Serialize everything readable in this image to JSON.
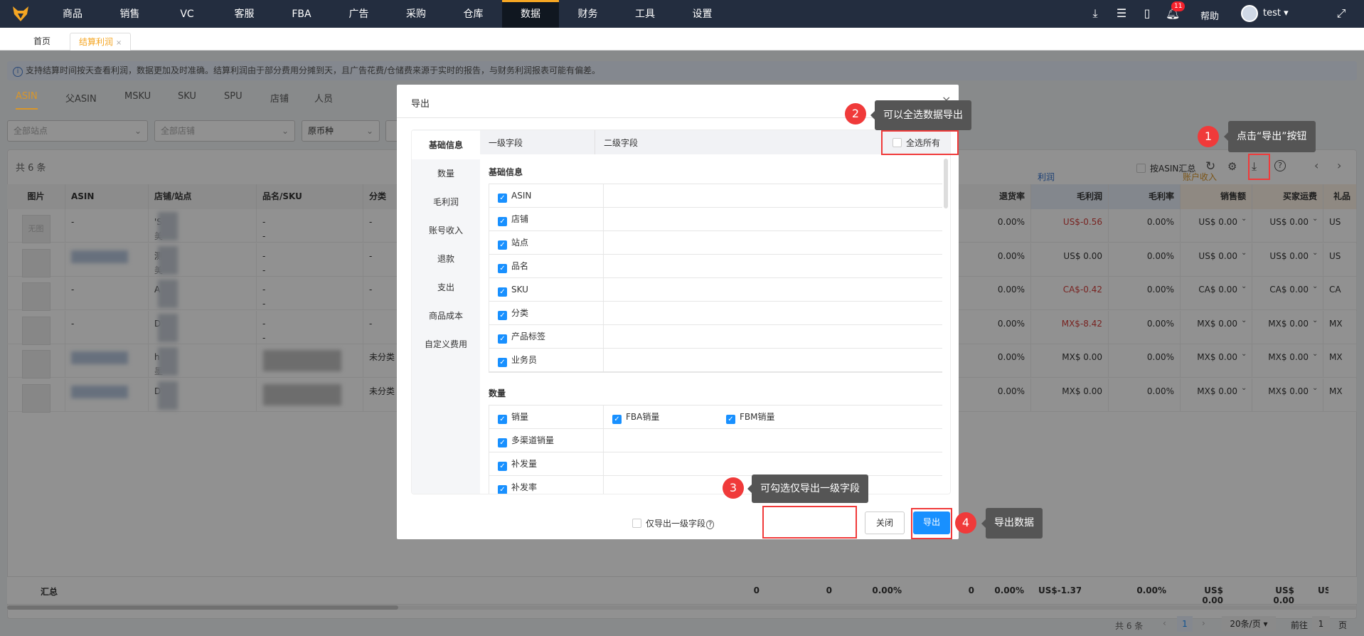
{
  "nav": {
    "items": [
      "商品",
      "销售",
      "VC",
      "客服",
      "FBA",
      "广告",
      "采购",
      "仓库",
      "数据",
      "财务",
      "工具",
      "设置"
    ],
    "active": 8,
    "help": "帮助",
    "user": "test",
    "notifications": "11"
  },
  "tabs": [
    {
      "label": "首页"
    },
    {
      "label": "结算利润",
      "close": "×"
    }
  ],
  "info": "支持结算时间按天查看利润，数据更加及时准确。结算利润由于部分费用分摊到天，且广告花费/仓储费来源于实时的报告，与财务利润报表可能有偏差。",
  "subtabs": [
    "ASIN",
    "父ASIN",
    "MSKU",
    "SKU",
    "SPU",
    "店铺",
    "人员"
  ],
  "filters": {
    "site": "全部站点",
    "store": "全部店铺",
    "currency": "原币种"
  },
  "table": {
    "count": "共 6 条",
    "asin_summary": "按ASIN汇总",
    "group_profit": "利润",
    "group_income": "账户收入",
    "left_headers": [
      "图片",
      "ASIN",
      "店铺/站点",
      "品名/SKU",
      "分类"
    ],
    "right_headers": [
      "退货率",
      "毛利润",
      "毛利率",
      "销售额",
      "买家运费",
      "礼品包"
    ],
    "no_image": "无图",
    "rows": [
      {
        "asin": "-",
        "store": "'S",
        "site": "美",
        "name": "-",
        "sku": "-",
        "cat": "-",
        "vals": [
          "0.00%",
          "US$-0.56",
          "0.00%",
          "US$ 0.00",
          "US$ 0.00",
          "US"
        ],
        "neg": true
      },
      {
        "asin": "",
        "store": "测",
        "site": "美",
        "name": "-",
        "sku": "-",
        "cat": "-",
        "vals": [
          "0.00%",
          "US$ 0.00",
          "0.00%",
          "US$ 0.00",
          "US$ 0.00",
          "US"
        ],
        "neg": false
      },
      {
        "asin": "-",
        "store": "A",
        "site": "",
        "name": "-",
        "sku": "-",
        "cat": "-",
        "vals": [
          "0.00%",
          "CA$-0.42",
          "0.00%",
          "CA$ 0.00",
          "CA$ 0.00",
          "CA"
        ],
        "neg": true
      },
      {
        "asin": "-",
        "store": "DY",
        "site": "",
        "name": "-",
        "sku": "-",
        "cat": "-",
        "vals": [
          "0.00%",
          "MX$-8.42",
          "0.00%",
          "MX$ 0.00",
          "MX$ 0.00",
          "MX"
        ],
        "neg": true
      },
      {
        "asin": "",
        "store": "h DY",
        "site": "墨",
        "name": "",
        "sku": "",
        "cat": "未分类",
        "vals": [
          "0.00%",
          "MX$ 0.00",
          "0.00%",
          "MX$ 0.00",
          "MX$ 0.00",
          "MX"
        ],
        "neg": false
      },
      {
        "asin": "",
        "store": "DY",
        "site": "",
        "name": "",
        "sku": "",
        "cat": "未分类",
        "vals": [
          "0.00%",
          "MX$ 0.00",
          "0.00%",
          "MX$ 0.00",
          "MX$ 0.00",
          "MX"
        ],
        "neg": false
      }
    ],
    "total_label": "汇总",
    "totals": [
      "0",
      "0",
      "0.00%",
      "0",
      "0.00%",
      "US$-1.37",
      "0.00%",
      "US$ 0.00",
      "US$ 0.00",
      "US"
    ]
  },
  "pagination": {
    "total": "共 6 条",
    "page": "1",
    "page_size": "20条/页",
    "goto": "前往",
    "goto_value": "1",
    "page_unit": "页"
  },
  "modal": {
    "title": "导出",
    "close": "×",
    "left_nav": [
      "基础信息",
      "数量",
      "毛利润",
      "账号收入",
      "退款",
      "支出",
      "商品成本",
      "自定义费用"
    ],
    "col1": "一级字段",
    "col2": "二级字段",
    "select_all": "全选所有",
    "sections": [
      {
        "title": "基础信息",
        "rows": [
          {
            "label": "ASIN"
          },
          {
            "label": "店铺"
          },
          {
            "label": "站点"
          },
          {
            "label": "品名"
          },
          {
            "label": "SKU"
          },
          {
            "label": "分类"
          },
          {
            "label": "产品标签"
          },
          {
            "label": "业务员"
          }
        ]
      },
      {
        "title": "数量",
        "rows": [
          {
            "label": "销量",
            "sub": [
              "FBA销量",
              "FBM销量"
            ]
          },
          {
            "label": "多渠道销量"
          },
          {
            "label": "补发量"
          },
          {
            "label": "补发率"
          }
        ]
      }
    ],
    "only_level1": "仅导出一级字段",
    "close_btn": "关闭",
    "export_btn": "导出"
  },
  "annotations": [
    {
      "num": "1",
      "text": "点击“导出”按钮"
    },
    {
      "num": "2",
      "text": "可以全选数据导出"
    },
    {
      "num": "3",
      "text": "可勾选仅导出一级字段"
    },
    {
      "num": "4",
      "text": "导出数据"
    }
  ]
}
